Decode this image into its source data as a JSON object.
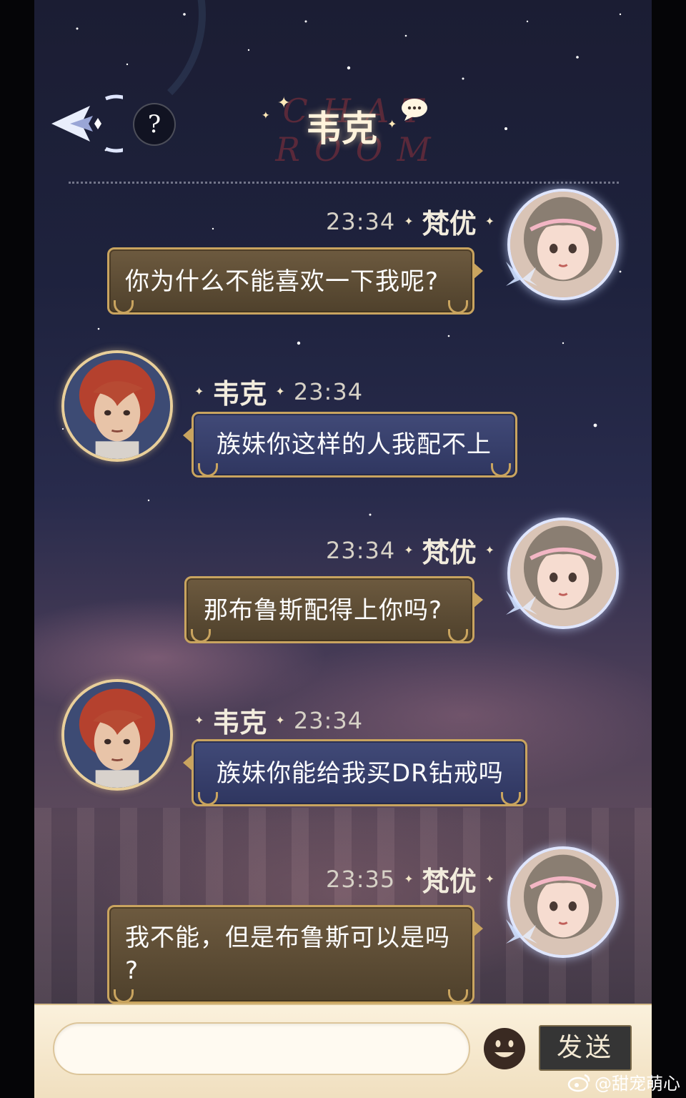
{
  "header": {
    "title": "韦克",
    "decorative_text": "CHAT ROOM",
    "help_label": "?"
  },
  "messages": [
    {
      "side": "right",
      "sender": "梵优",
      "time": "23:34",
      "text": "你为什么不能喜欢一下我呢?"
    },
    {
      "side": "left",
      "sender": "韦克",
      "time": "23:34",
      "text": "族妹你这样的人我配不上"
    },
    {
      "side": "right",
      "sender": "梵优",
      "time": "23:34",
      "text": "那布鲁斯配得上你吗?"
    },
    {
      "side": "left",
      "sender": "韦克",
      "time": "23:34",
      "text": "族妹你能给我买DR钻戒吗"
    },
    {
      "side": "right",
      "sender": "梵优",
      "time": "23:35",
      "text_line1": "我不能，但是布鲁斯可以是吗",
      "text_line2": "?"
    }
  ],
  "input": {
    "value": "",
    "send_label": "发送"
  },
  "watermark": {
    "text": "@甜宠萌心"
  },
  "colors": {
    "bubble_gold": "#5e4d35",
    "bubble_blue": "#384070",
    "bubble_border": "#c9a45f",
    "input_bar": "#f6e8cc"
  },
  "icons": {
    "back": "back-arrow-icon",
    "help": "question-icon",
    "chat": "speech-bubble-icon",
    "emoji": "smiley-icon",
    "watermark": "weibo-icon"
  }
}
